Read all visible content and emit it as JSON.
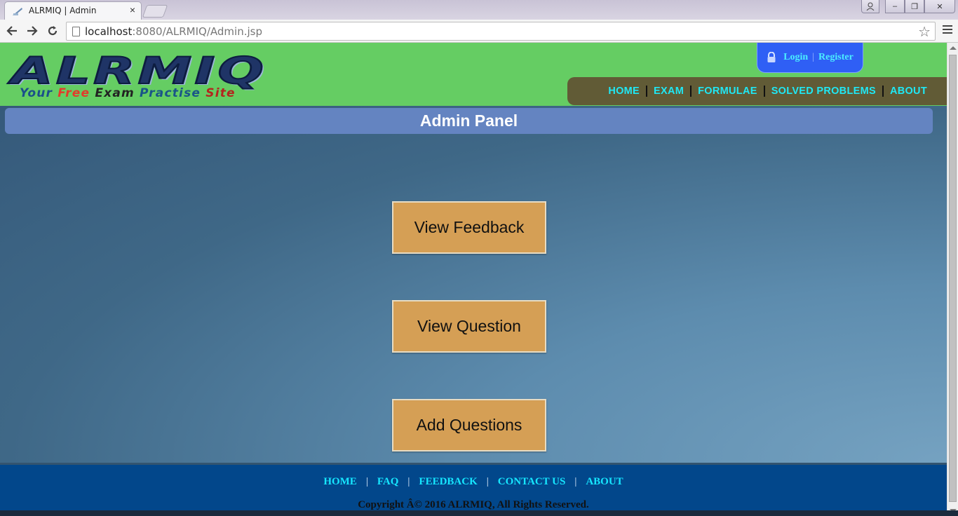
{
  "browser": {
    "tab_title": "ALRMIQ | Admin",
    "tab_close": "×",
    "url_host": "localhost",
    "url_rest": ":8080/ALRMIQ/Admin.jsp",
    "window_controls": [
      "–",
      "❐",
      "✕"
    ]
  },
  "site": {
    "logo_text": "ALRMIQ",
    "tagline": {
      "w1": "Your",
      "w2": "Free",
      "w3": "Exam",
      "w4": "Practise",
      "w5": "Site"
    },
    "auth": {
      "login": "Login",
      "separator": "|",
      "register": "Register"
    },
    "nav": [
      "HOME",
      "EXAM",
      "FORMULAE",
      "SOLVED PROBLEMS",
      "ABOUT"
    ]
  },
  "admin": {
    "title": "Admin Panel",
    "buttons": [
      "View Feedback",
      "View Question",
      "Add Questions"
    ]
  },
  "footer": {
    "links": [
      "HOME",
      "FAQ",
      "FEEDBACK",
      "CONTACT US",
      "ABOUT"
    ],
    "separator": "|",
    "copyright": "Copyright Â© 2016 ALRMIQ, All Rights Reserved."
  },
  "colors": {
    "header_green": "#65cd63",
    "nav_bg": "#615b36",
    "nav_link": "#1fe8f5",
    "auth_bg": "#2f5ff5",
    "panel_title_bg": "#6484c1",
    "admin_button": "#d59f55",
    "footer_bg": "#02478b"
  }
}
